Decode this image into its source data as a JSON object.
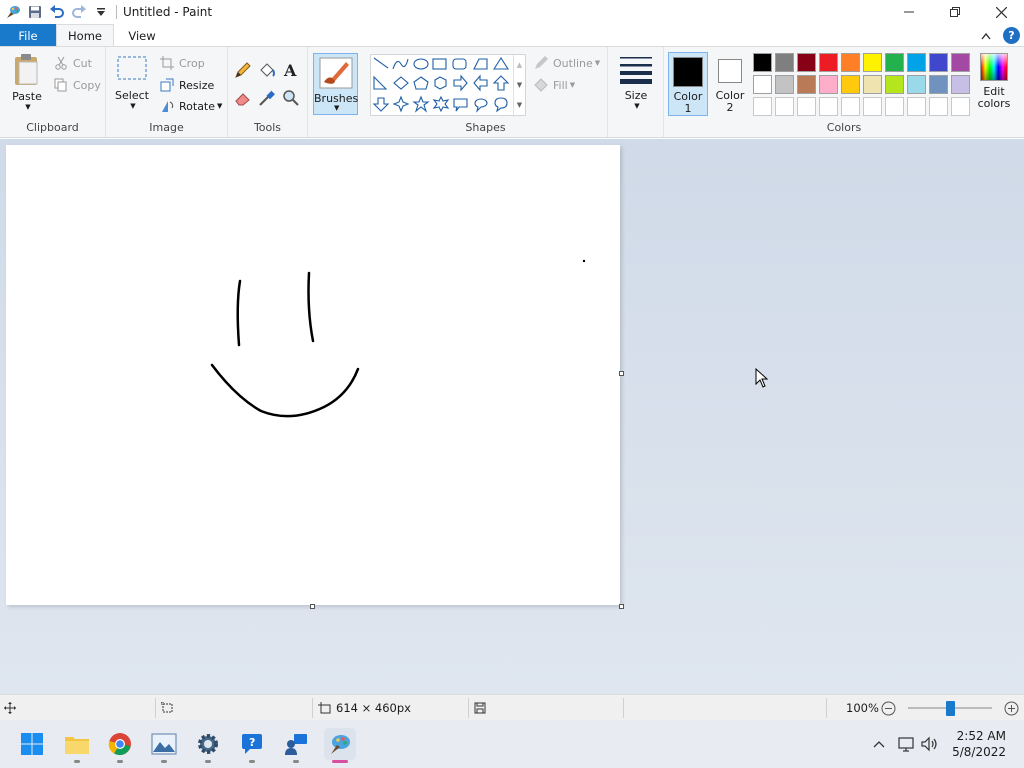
{
  "window": {
    "title": "Untitled - Paint"
  },
  "tabs": {
    "file": "File",
    "home": "Home",
    "view": "View"
  },
  "clipboard": {
    "paste": "Paste",
    "cut": "Cut",
    "copy": "Copy",
    "label": "Clipboard"
  },
  "image": {
    "select": "Select",
    "crop": "Crop",
    "resize": "Resize",
    "rotate": "Rotate",
    "label": "Image"
  },
  "tools": {
    "label": "Tools"
  },
  "brushes": {
    "label": "Brushes"
  },
  "shapes": {
    "outline": "Outline",
    "fill": "Fill",
    "label": "Shapes"
  },
  "size": {
    "label": "Size"
  },
  "colors": {
    "color1": "Color",
    "color1_num": "1",
    "color2": "Color",
    "color2_num": "2",
    "edit1": "Edit",
    "edit2": "colors",
    "label": "Colors",
    "color1_value": "#000000",
    "color2_value": "#ffffff",
    "row1": [
      "#000000",
      "#7f7f7f",
      "#880015",
      "#ed1c24",
      "#ff7f27",
      "#fff200",
      "#22b14c",
      "#00a2e8",
      "#3f48cc",
      "#a349a4"
    ],
    "row2": [
      "#ffffff",
      "#c3c3c3",
      "#b97a57",
      "#ffaec9",
      "#ffc90e",
      "#efe4b0",
      "#b5e61d",
      "#99d9ea",
      "#7092be",
      "#c8bfe7"
    ]
  },
  "status": {
    "dimensions": "614 × 460px",
    "zoom": "100%"
  },
  "taskbar": {
    "time": "2:52 AM",
    "date": "5/8/2022"
  }
}
